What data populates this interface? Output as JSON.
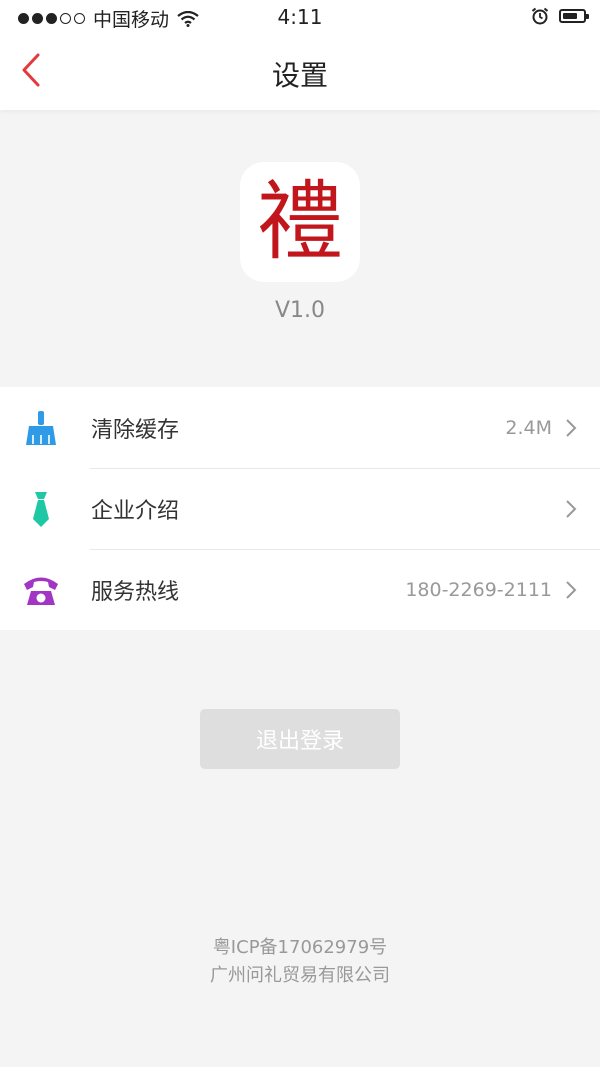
{
  "status_bar": {
    "carrier": "中国移动",
    "time": "4:11",
    "signal_full_dots": 3,
    "signal_total_dots": 5,
    "battery_level": 0.75
  },
  "nav": {
    "title": "设置",
    "back_icon": "chevron-left-icon",
    "accent_color": "#e4393c"
  },
  "app": {
    "logo_text": "禮",
    "version": "V1.0"
  },
  "settings": [
    {
      "label": "清除缓存",
      "value": "2.4M",
      "icon": "broom-icon",
      "icon_color": "#2f9be6"
    },
    {
      "label": "企业介绍",
      "value": "",
      "icon": "tie-icon",
      "icon_color": "#1ec8a4"
    },
    {
      "label": "服务热线",
      "value": "180-2269-2111",
      "icon": "phone-icon",
      "icon_color": "#a235c4"
    }
  ],
  "logout": {
    "label": "退出登录"
  },
  "footer": {
    "icp": "粤ICP备17062979号",
    "company": "广州问礼贸易有限公司"
  }
}
